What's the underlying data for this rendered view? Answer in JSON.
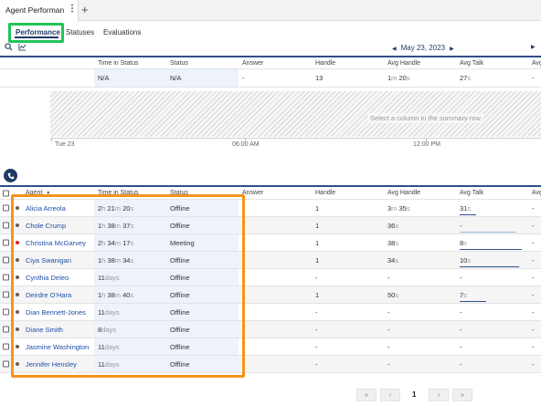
{
  "tabs": {
    "active_label": "Agent Performance",
    "kebab": "⋮",
    "add": "+"
  },
  "subnav": [
    {
      "label": "Performance",
      "active": true
    },
    {
      "label": "Statuses",
      "active": false
    },
    {
      "label": "Evaluations",
      "active": false
    }
  ],
  "toolbar": {
    "search_icon": "search-icon",
    "chart_icon": "chart-icon"
  },
  "date_nav": {
    "prev": "◀",
    "date": "May 23, 2023",
    "next": "▶",
    "end": "▶"
  },
  "columns": [
    "Time in Status",
    "Status",
    "Answer",
    "Handle",
    "Avg Handle",
    "Avg Talk",
    "Avg"
  ],
  "summary": {
    "time_in_status": "N/A",
    "status": "N/A",
    "answer": "-",
    "handle": "13",
    "avg_handle": {
      "a": "1",
      "au": "m",
      "b": "20",
      "bu": "s"
    },
    "avg_talk": {
      "a": "27",
      "au": "s"
    },
    "avg": "-"
  },
  "timeline": {
    "hint": "Select a column in the summary row",
    "labels": [
      "Tue 23",
      "06:00 AM",
      "12:00 PM"
    ]
  },
  "table": {
    "agent_header": "Agent",
    "sort_icon": "▼",
    "rows": [
      {
        "name": "Alicia Arreola",
        "tis": [
          [
            "2",
            "h"
          ],
          [
            "21",
            "m"
          ],
          [
            "20",
            "s"
          ]
        ],
        "status": "Offline",
        "answer": "",
        "handle": "1",
        "avg_handle": [
          [
            "3",
            "m"
          ],
          [
            "35",
            "s"
          ]
        ],
        "avg_talk": [
          [
            "31",
            "s"
          ]
        ],
        "avg": "-",
        "dot": "normal",
        "bar": 0.25
      },
      {
        "name": "Chole Crump",
        "tis": [
          [
            "1",
            "h"
          ],
          [
            "38",
            "m"
          ],
          [
            "37",
            "s"
          ]
        ],
        "status": "Offline",
        "answer": "",
        "handle": "1",
        "avg_handle": [
          [
            "36",
            "s"
          ]
        ],
        "avg_talk": [
          [
            "-",
            ""
          ]
        ],
        "avg": "-",
        "dot": "normal",
        "bar": 0.85
      },
      {
        "name": "Christina McGarvey",
        "tis": [
          [
            "2",
            "h"
          ],
          [
            "34",
            "m"
          ],
          [
            "17",
            "s"
          ]
        ],
        "status": "Meeting",
        "answer": "",
        "handle": "1",
        "avg_handle": [
          [
            "38",
            "s"
          ]
        ],
        "avg_talk": [
          [
            "8",
            "s"
          ]
        ],
        "avg": "-",
        "dot": "red",
        "bar": 0.95
      },
      {
        "name": "Ciya Swanigan",
        "tis": [
          [
            "1",
            "h"
          ],
          [
            "38",
            "m"
          ],
          [
            "34",
            "s"
          ]
        ],
        "status": "Offline",
        "answer": "",
        "handle": "1",
        "avg_handle": [
          [
            "34",
            "s"
          ]
        ],
        "avg_talk": [
          [
            "10",
            "s"
          ]
        ],
        "avg": "-",
        "dot": "normal",
        "bar": 0.9
      },
      {
        "name": "Cynthia Deleo",
        "tis": [
          [
            "11",
            " days"
          ]
        ],
        "status": "Offline",
        "answer": "",
        "handle": "-",
        "avg_handle": [
          [
            "-",
            ""
          ]
        ],
        "avg_talk": [
          [
            "-",
            ""
          ]
        ],
        "avg": "-",
        "dot": "normal",
        "bar": 0
      },
      {
        "name": "Deirdre O'Hara",
        "tis": [
          [
            "1",
            "h"
          ],
          [
            "38",
            "m"
          ],
          [
            "40",
            "s"
          ]
        ],
        "status": "Offline",
        "answer": "",
        "handle": "1",
        "avg_handle": [
          [
            "50",
            "s"
          ]
        ],
        "avg_talk": [
          [
            "7",
            "s"
          ]
        ],
        "avg": "-",
        "dot": "normal",
        "bar": 0.4
      },
      {
        "name": "Dian Bennett-Jones",
        "tis": [
          [
            "11",
            " days"
          ]
        ],
        "status": "Offline",
        "answer": "",
        "handle": "-",
        "avg_handle": [
          [
            "-",
            ""
          ]
        ],
        "avg_talk": [
          [
            "-",
            ""
          ]
        ],
        "avg": "-",
        "dot": "normal",
        "bar": 0
      },
      {
        "name": "Diane Smith",
        "tis": [
          [
            "8",
            " days"
          ]
        ],
        "status": "Offline",
        "answer": "",
        "handle": "-",
        "avg_handle": [
          [
            "-",
            ""
          ]
        ],
        "avg_talk": [
          [
            "-",
            ""
          ]
        ],
        "avg": "-",
        "dot": "normal",
        "bar": 0
      },
      {
        "name": "Jasmine Washington",
        "tis": [
          [
            "11",
            " days"
          ]
        ],
        "status": "Offline",
        "answer": "",
        "handle": "-",
        "avg_handle": [
          [
            "-",
            ""
          ]
        ],
        "avg_talk": [
          [
            "-",
            ""
          ]
        ],
        "avg": "-",
        "dot": "normal",
        "bar": 0
      },
      {
        "name": "Jennifer Hensley",
        "tis": [
          [
            "11",
            " days"
          ]
        ],
        "status": "Offline",
        "answer": "",
        "handle": "-",
        "avg_handle": [
          [
            "-",
            ""
          ]
        ],
        "avg_talk": [
          [
            "-",
            ""
          ]
        ],
        "avg": "-",
        "dot": "normal",
        "bar": 0
      }
    ]
  },
  "pager": {
    "first": "«",
    "prev": "‹",
    "page": "1",
    "next": "›",
    "last": "»"
  },
  "colors": {
    "accent": "#1f3a68",
    "highlight_green": "#21c45a",
    "highlight_orange": "#f7931e",
    "link": "#1f4fa8"
  }
}
